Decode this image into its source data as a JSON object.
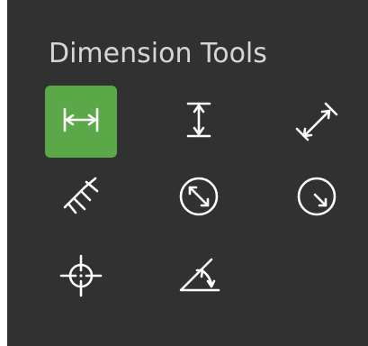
{
  "panel": {
    "title": "Dimension Tools",
    "colors": {
      "background": "#313131",
      "title_text": "#d6d6d6",
      "icon": "#ffffff",
      "selected": "#5ba848"
    },
    "tools": [
      {
        "icon": "horizontal-dimension-icon",
        "selected": true
      },
      {
        "icon": "vertical-dimension-icon",
        "selected": false
      },
      {
        "icon": "aligned-dimension-icon",
        "selected": false
      },
      {
        "icon": "rotated-dimension-icon",
        "selected": false
      },
      {
        "icon": "diameter-dimension-icon",
        "selected": false
      },
      {
        "icon": "radius-dimension-icon",
        "selected": false
      },
      {
        "icon": "center-mark-icon",
        "selected": false
      },
      {
        "icon": "angular-dimension-icon",
        "selected": false
      }
    ]
  }
}
